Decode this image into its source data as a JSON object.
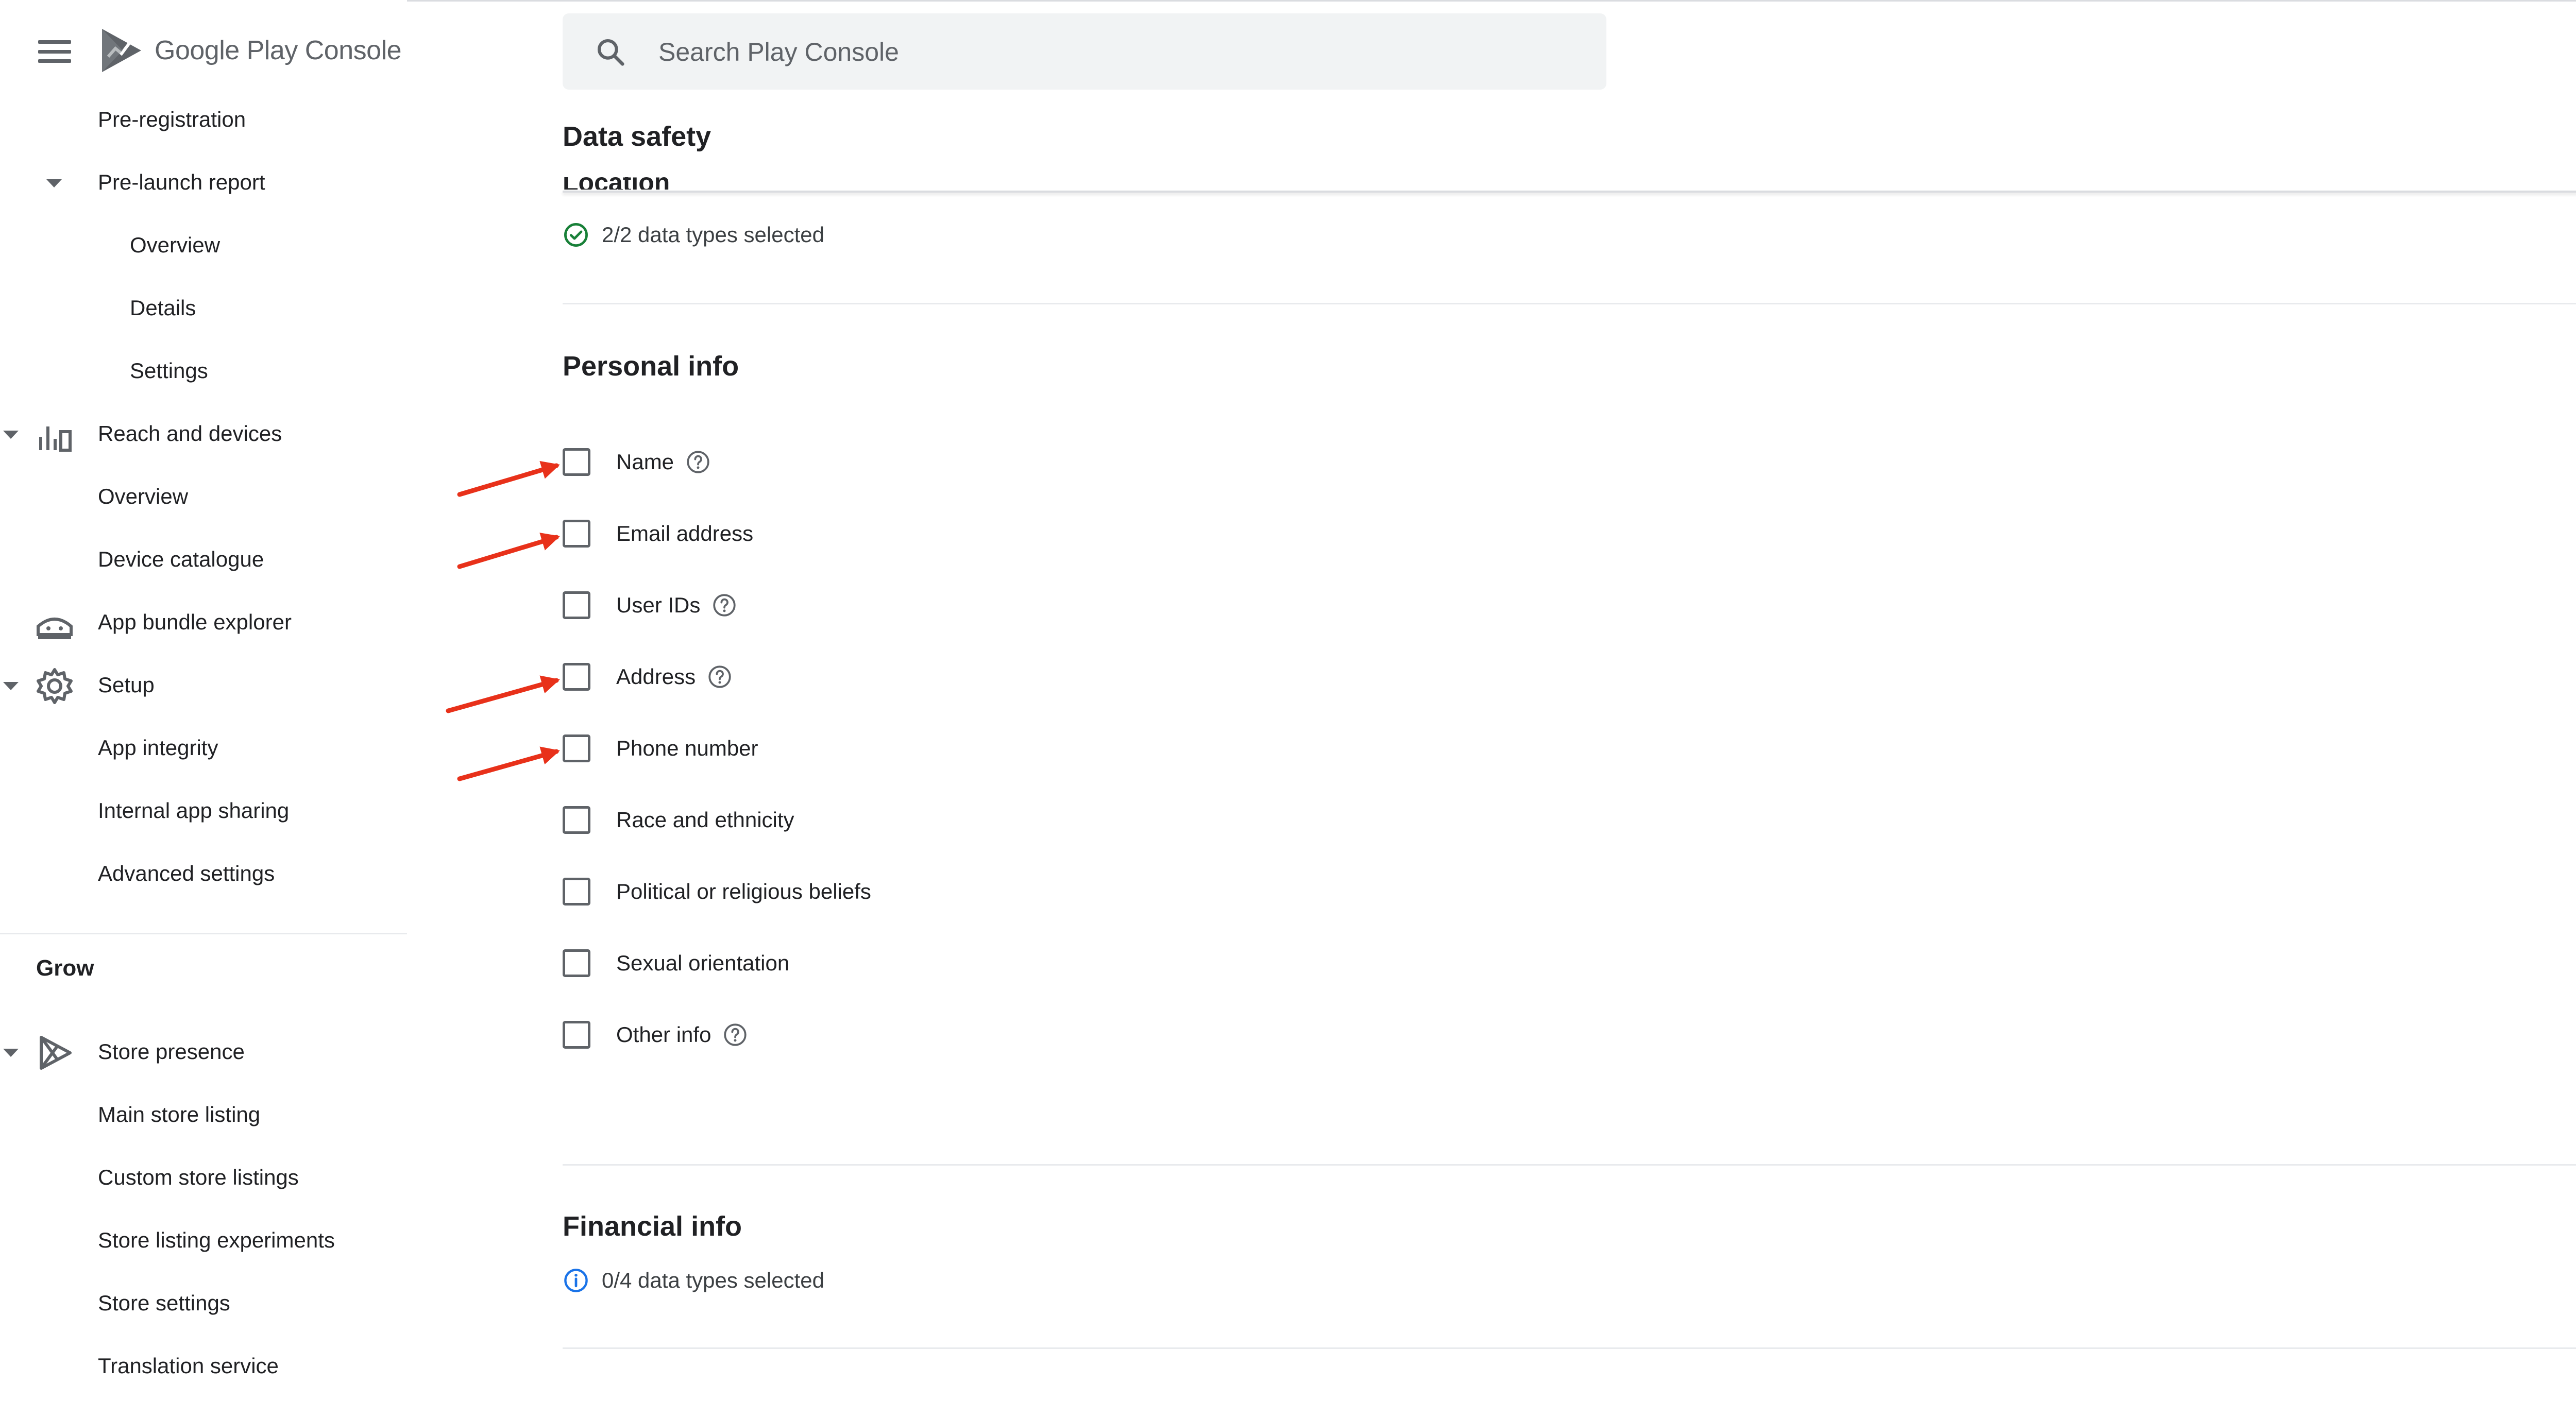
{
  "app": {
    "logo_text_google": "Google Play",
    "logo_text_console": "Console"
  },
  "search": {
    "placeholder": "Search Play Console"
  },
  "sidebar": {
    "items": [
      {
        "label": "Pre-registration"
      },
      {
        "label": "Pre-launch report"
      },
      {
        "label": "Overview"
      },
      {
        "label": "Details"
      },
      {
        "label": "Settings"
      },
      {
        "label": "Reach and devices"
      },
      {
        "label": "Overview"
      },
      {
        "label": "Device catalogue"
      },
      {
        "label": "App bundle explorer"
      },
      {
        "label": "Setup"
      },
      {
        "label": "App integrity"
      },
      {
        "label": "Internal app sharing"
      },
      {
        "label": "Advanced settings"
      },
      {
        "label": "Store presence"
      },
      {
        "label": "Main store listing"
      },
      {
        "label": "Custom store listings"
      },
      {
        "label": "Store listing experiments"
      },
      {
        "label": "Store settings"
      },
      {
        "label": "Translation service"
      }
    ],
    "grow_title": "Grow"
  },
  "main": {
    "page_title": "Data safety",
    "location_clipped": "Location",
    "location_status": "2/2 data types selected",
    "personal_info": {
      "heading": "Personal info",
      "options": [
        {
          "label": "Name",
          "checked": false,
          "help": true
        },
        {
          "label": "Email address",
          "checked": false,
          "help": false
        },
        {
          "label": "User IDs",
          "checked": false,
          "help": true
        },
        {
          "label": "Address",
          "checked": false,
          "help": true
        },
        {
          "label": "Phone number",
          "checked": false,
          "help": false
        },
        {
          "label": "Race and ethnicity",
          "checked": false,
          "help": false
        },
        {
          "label": "Political or religious beliefs",
          "checked": false,
          "help": false
        },
        {
          "label": "Sexual orientation",
          "checked": false,
          "help": false
        },
        {
          "label": "Other info",
          "checked": false,
          "help": true
        }
      ]
    },
    "financial_info": {
      "heading": "Financial info",
      "status": "0/4 data types selected"
    }
  },
  "colors": {
    "accent_green": "#188038",
    "info_blue": "#1a73e8",
    "annotation_arrow": "#e8311a",
    "icon_grey": "#5f6368"
  }
}
